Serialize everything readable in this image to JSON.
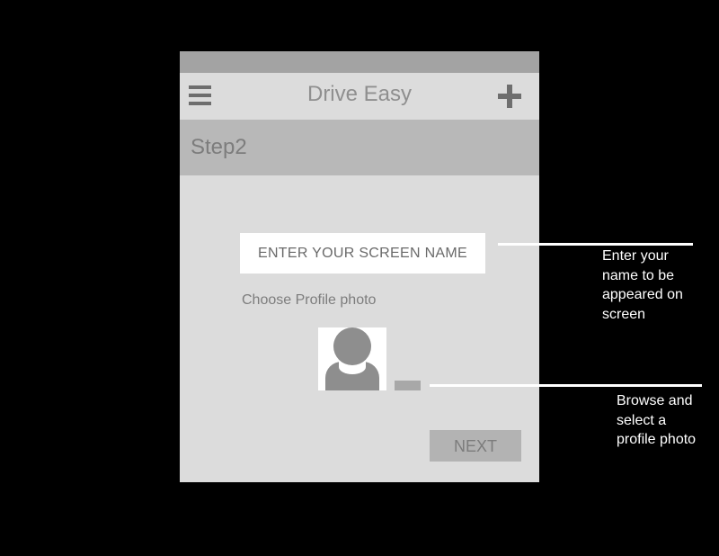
{
  "app": {
    "title": "Drive Easy",
    "icons": {
      "menu": "hamburger-menu-icon",
      "add": "plus-icon"
    }
  },
  "step": {
    "title": "Step2"
  },
  "form": {
    "screen_name_placeholder": "ENTER YOUR SCREEN NAME",
    "screen_name_value": "",
    "profile_photo_label": "Choose Profile photo",
    "next_label": "NEXT"
  },
  "annotations": {
    "screen_name_note": "Enter your\nname to be\nappeared on\nscreen",
    "photo_note": "Browse and\nselect a\nprofile photo"
  },
  "colors": {
    "background": "#000000",
    "phone_body": "#dcdcdc",
    "status_bar": "#a3a3a3",
    "step_bar": "#b8b8b8",
    "button": "#b3b3b3",
    "annotation": "#ffffff"
  }
}
